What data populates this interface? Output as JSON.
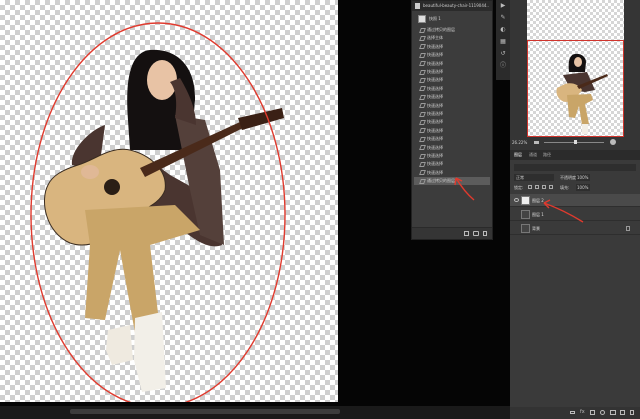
{
  "document_tab": {
    "title": "beautiful-beauty-chair-1119044..."
  },
  "history": {
    "snapshot_label": "快照 1",
    "items": [
      {
        "label": "通过拷贝的图层"
      },
      {
        "label": "选择主体"
      },
      {
        "label": "快速选择"
      },
      {
        "label": "快速选择"
      },
      {
        "label": "快速选择"
      },
      {
        "label": "快速选择"
      },
      {
        "label": "快速选择"
      },
      {
        "label": "快速选择"
      },
      {
        "label": "快速选择"
      },
      {
        "label": "快速选择"
      },
      {
        "label": "快速选择"
      },
      {
        "label": "快速选择"
      },
      {
        "label": "快速选择"
      },
      {
        "label": "快速选择"
      },
      {
        "label": "快速选择"
      },
      {
        "label": "快速选择"
      },
      {
        "label": "快速选择"
      },
      {
        "label": "快速选择"
      },
      {
        "label": "通过拷贝的图层"
      }
    ],
    "selected_index": 18
  },
  "navigator": {
    "zoom": "26.22%"
  },
  "layers_panel": {
    "tabs": [
      "图层",
      "通道",
      "路径"
    ],
    "blend_mode": "正常",
    "opacity_label": "不透明度:",
    "opacity_value": "100%",
    "lock_label": "锁定:",
    "fill_label": "填充:",
    "fill_value": "100%",
    "layers": [
      {
        "name": "图层 2",
        "selected": true,
        "visible": true,
        "type": "cutout"
      },
      {
        "name": "图层 1",
        "selected": false,
        "visible": false,
        "type": "photo"
      },
      {
        "name": "背景",
        "selected": false,
        "visible": false,
        "type": "background",
        "locked": true
      }
    ]
  },
  "colors": {
    "annotation_red": "#e03a2e",
    "panel_bg": "#3c3c3c",
    "selected_row": "#5c5c5c"
  }
}
